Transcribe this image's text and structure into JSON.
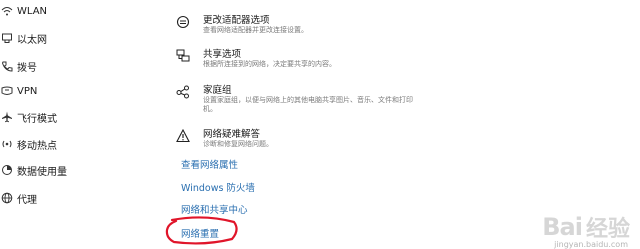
{
  "sidebar": {
    "items": [
      {
        "label": "WLAN",
        "icon": "wifi-icon"
      },
      {
        "label": "以太网",
        "icon": "ethernet-icon"
      },
      {
        "label": "拨号",
        "icon": "dialup-icon"
      },
      {
        "label": "VPN",
        "icon": "vpn-icon"
      },
      {
        "label": "飞行模式",
        "icon": "airplane-icon"
      },
      {
        "label": "移动热点",
        "icon": "hotspot-icon"
      },
      {
        "label": "数据使用量",
        "icon": "data-usage-icon"
      },
      {
        "label": "代理",
        "icon": "globe-icon"
      }
    ]
  },
  "main": {
    "settings": [
      {
        "title": "更改适配器选项",
        "desc": "查看网络适配器并更改连接设置。",
        "icon": "adapter-icon"
      },
      {
        "title": "共享选项",
        "desc": "根据所连接到的网络，决定要共享的内容。",
        "icon": "sharing-icon"
      },
      {
        "title": "家庭组",
        "desc": "设置家庭组，以便与网络上的其他电脑共享图片、音乐、文件和打印",
        "desc2": "机。",
        "icon": "homegroup-icon"
      },
      {
        "title": "网络疑难解答",
        "desc": "诊断和修复网络问题。",
        "icon": "warning-icon"
      }
    ],
    "links": [
      {
        "label": "查看网络属性"
      },
      {
        "label": "Windows 防火墙"
      },
      {
        "label": "网络和共享中心"
      },
      {
        "label": "网络重置"
      }
    ]
  },
  "colors": {
    "link": "#2a6fb0",
    "annotation": "#e0152a"
  },
  "watermark": {
    "logo": "Bai",
    "cn": "经验",
    "url": "jingyan.baidu.com"
  }
}
